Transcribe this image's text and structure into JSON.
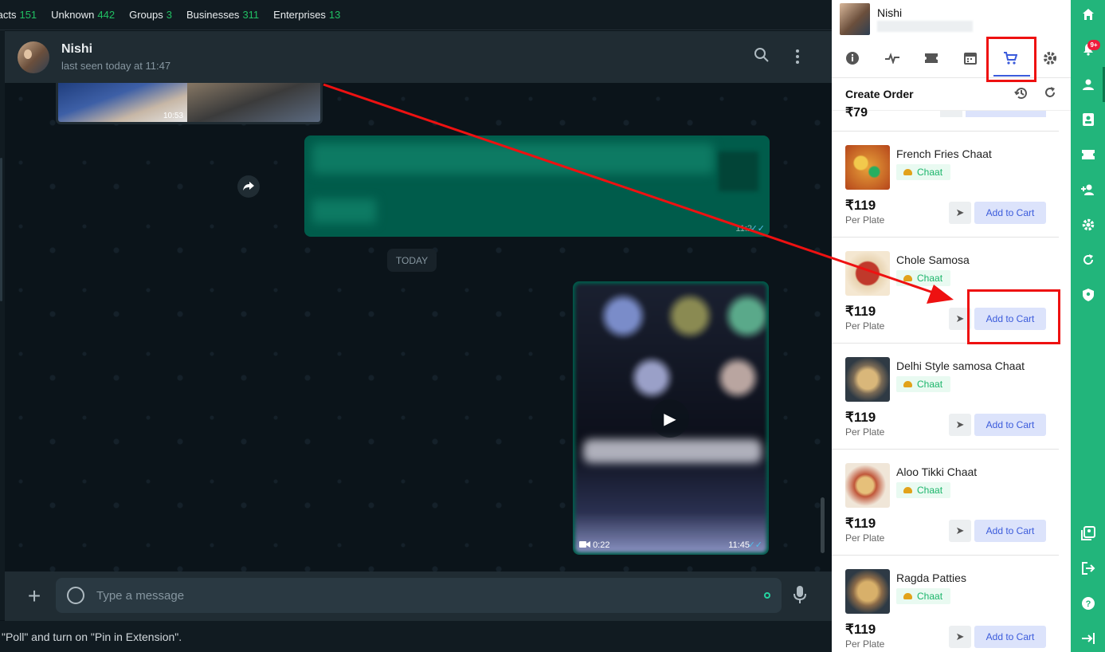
{
  "filters": [
    {
      "label": "tacts",
      "count": "151"
    },
    {
      "label": "Unknown",
      "count": "442"
    },
    {
      "label": "Groups",
      "count": "3"
    },
    {
      "label": "Businesses",
      "count": "311"
    },
    {
      "label": "Enterprises",
      "count": "13"
    }
  ],
  "chat": {
    "name": "Nishi",
    "last_seen": "last seen today at 11:47",
    "image_time": "10:53",
    "green_time": "11:2",
    "day_label": "TODAY",
    "video_duration": "0:22",
    "video_time": "11:45",
    "composer_placeholder": "Type a message"
  },
  "bottom_note": "\"Poll\" and turn on \"Pin in Extension\".",
  "panel": {
    "contact_name": "Nishi",
    "title": "Create Order",
    "prev_price": "₹79",
    "items": [
      {
        "name": "French Fries Chaat",
        "category": "Chaat",
        "price": "₹119",
        "unit": "Per Plate",
        "button": "Add to Cart"
      },
      {
        "name": "Chole Samosa",
        "category": "Chaat",
        "price": "₹119",
        "unit": "Per Plate",
        "button": "Add to Cart"
      },
      {
        "name": "Delhi Style samosa Chaat",
        "category": "Chaat",
        "price": "₹119",
        "unit": "Per Plate",
        "button": "Add to Cart"
      },
      {
        "name": "Aloo Tikki Chaat",
        "category": "Chaat",
        "price": "₹119",
        "unit": "Per Plate",
        "button": "Add to Cart"
      },
      {
        "name": "Ragda Patties",
        "category": "Chaat",
        "price": "₹119",
        "unit": "Per Plate",
        "button": "Add to Cart"
      }
    ]
  },
  "sidebar": {
    "notification_badge": "9+"
  },
  "colors": {
    "accent_green": "#22b57b",
    "whatsapp_bubble": "#005c4b",
    "cart_button_bg": "#dce3fb",
    "cart_button_text": "#3b5bdb",
    "highlight_red": "#ee1111"
  },
  "icons": [
    "info-icon",
    "activity-icon",
    "ticket-icon",
    "calendar-icon",
    "cart-icon",
    "settings-icon",
    "history-icon",
    "refresh-icon",
    "send-icon",
    "home-icon",
    "bell-icon",
    "user-icon",
    "contacts-icon",
    "add-user-icon",
    "shield-icon",
    "gallery-icon",
    "logout-icon",
    "help-icon",
    "collapse-icon"
  ]
}
